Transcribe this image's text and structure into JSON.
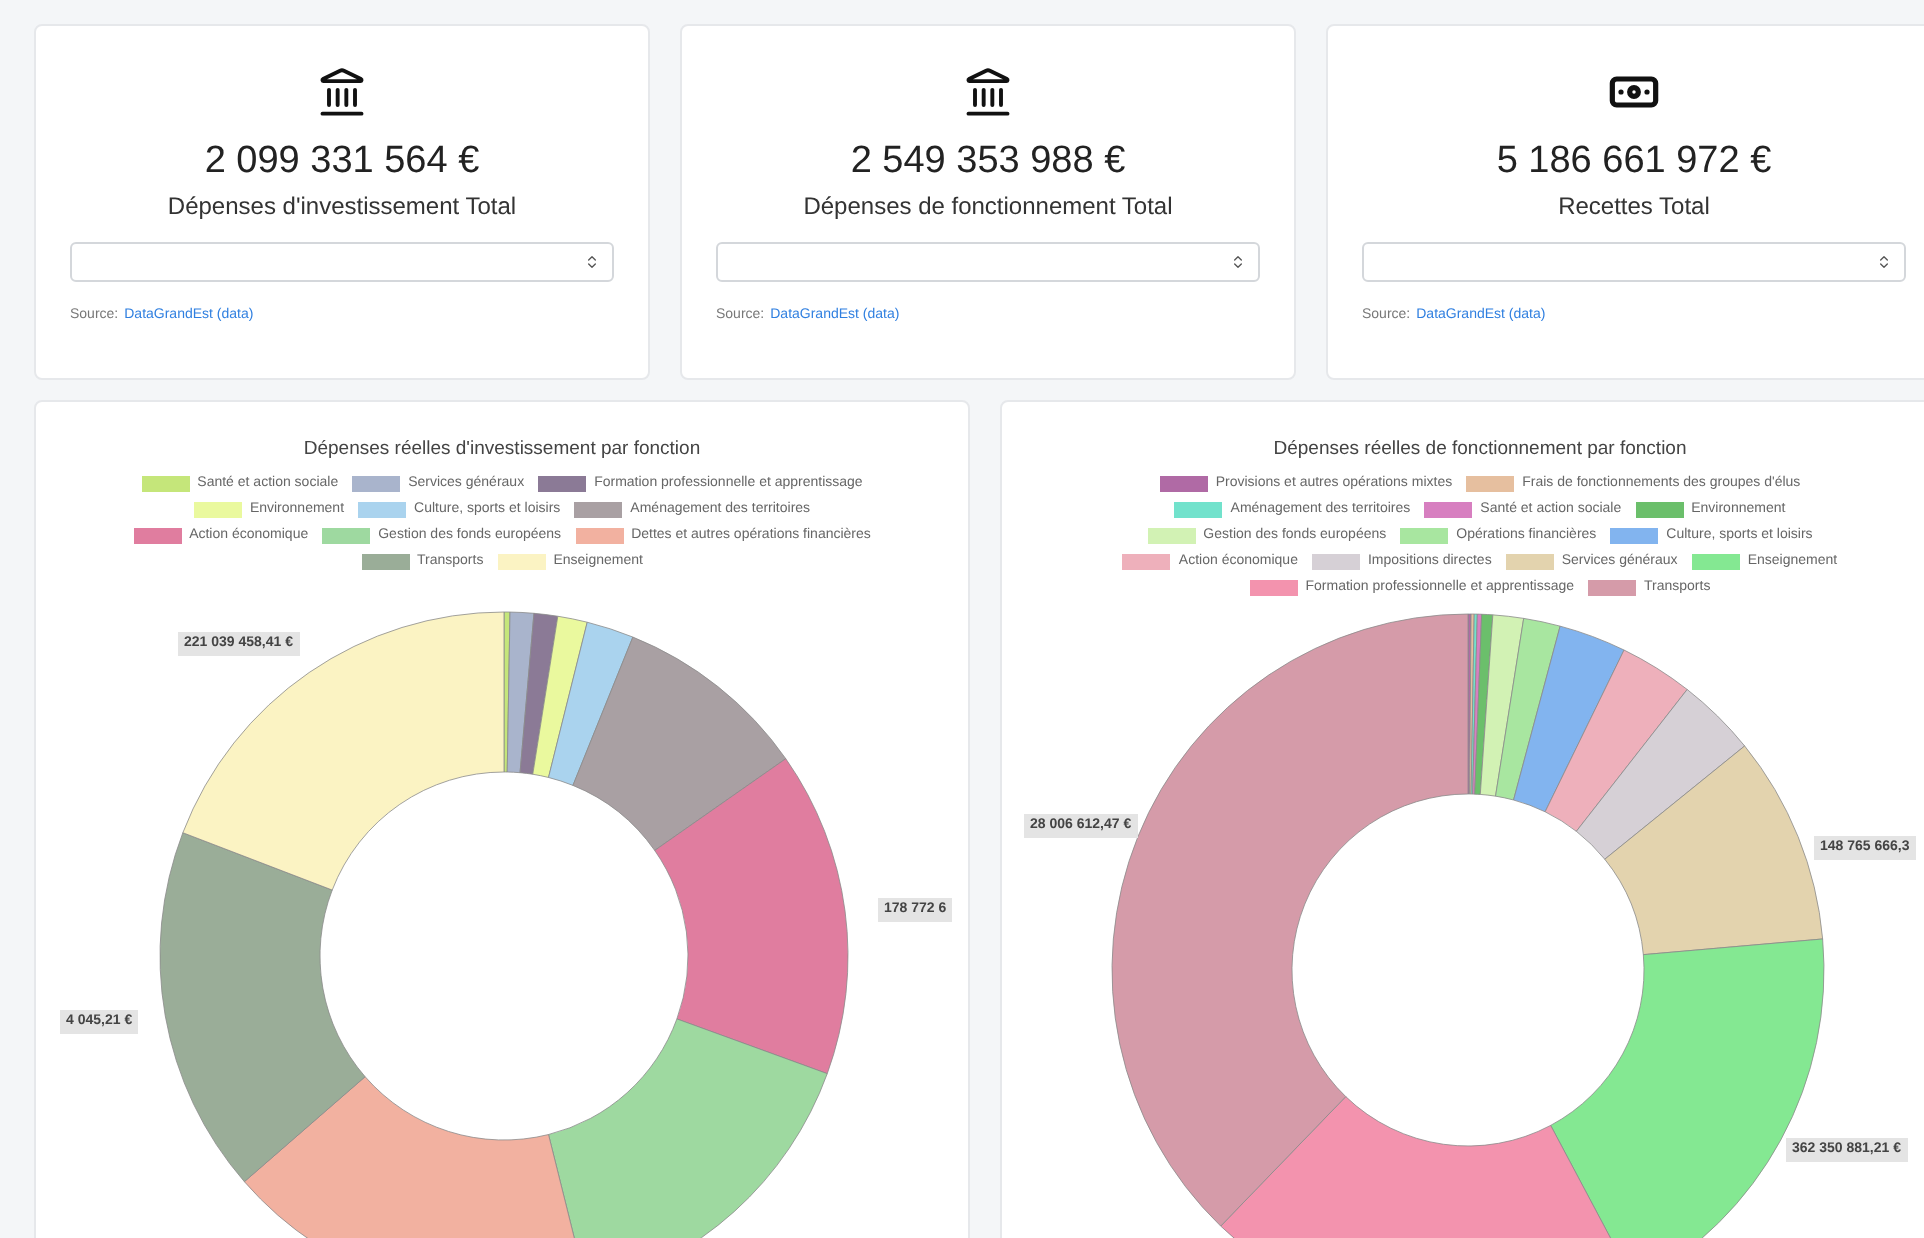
{
  "summary_cards": [
    {
      "amount": "2 099 331 564 €",
      "label": "Dépenses d'investissement Total",
      "source_label": "Source:",
      "source_link": "DataGrandEst (data)"
    },
    {
      "amount": "2 549 353 988 €",
      "label": "Dépenses de fonctionnement Total",
      "source_label": "Source:",
      "source_link": "DataGrandEst (data)"
    },
    {
      "amount": "5 186 661 972 €",
      "label": "Recettes Total",
      "source_label": "Source:",
      "source_link": "DataGrandEst (data)"
    }
  ],
  "charts": [
    {
      "title": "Dépenses réelles d'investissement par fonction",
      "legend": [
        {
          "label": "Santé et action sociale",
          "color": "#c5e67a"
        },
        {
          "label": "Services généraux",
          "color": "#a9b4cc"
        },
        {
          "label": "Formation professionnelle et apprentissage",
          "color": "#8b7a96"
        },
        {
          "label": "Environnement",
          "color": "#eaf99e"
        },
        {
          "label": "Culture, sports et loisirs",
          "color": "#aad3ee"
        },
        {
          "label": "Aménagement des territoires",
          "color": "#a9a0a3"
        },
        {
          "label": "Action économique",
          "color": "#e07d9f"
        },
        {
          "label": "Gestion des fonds européens",
          "color": "#9ed9a0"
        },
        {
          "label": "Dettes et autres opérations financières",
          "color": "#f2b1a0"
        },
        {
          "label": "Transports",
          "color": "#9aad98"
        },
        {
          "label": "Enseignement",
          "color": "#fbf3c3"
        }
      ],
      "value_labels": [
        "221 039 458,41 €",
        "178 772 6",
        "4 045,21 €"
      ]
    },
    {
      "title": "Dépenses réelles de fonctionnement par fonction",
      "legend": [
        {
          "label": "Provisions et autres opérations mixtes",
          "color": "#b06aa5"
        },
        {
          "label": "Frais de fonctionnements des groupes d'élus",
          "color": "#e6bf9f"
        },
        {
          "label": "Aménagement des territoires",
          "color": "#72e2cc"
        },
        {
          "label": "Santé et action sociale",
          "color": "#d77fc0"
        },
        {
          "label": "Environnement",
          "color": "#6bbf6b"
        },
        {
          "label": "Gestion des fonds européens",
          "color": "#d2f2b4"
        },
        {
          "label": "Opérations financières",
          "color": "#a8e6a0"
        },
        {
          "label": "Culture, sports et loisirs",
          "color": "#82b4ef"
        },
        {
          "label": "Action économique",
          "color": "#eeb0bb"
        },
        {
          "label": "Impositions directes",
          "color": "#d6d0d6"
        },
        {
          "label": "Services généraux",
          "color": "#e3d3ae"
        },
        {
          "label": "Enseignement",
          "color": "#84e892"
        },
        {
          "label": "Formation professionnelle et apprentissage",
          "color": "#f393ae"
        },
        {
          "label": "Transports",
          "color": "#d59ba9"
        }
      ],
      "value_labels": [
        "28 006 612,47 €",
        "148 765 666,3",
        "362 350 881,21 €"
      ]
    }
  ]
}
